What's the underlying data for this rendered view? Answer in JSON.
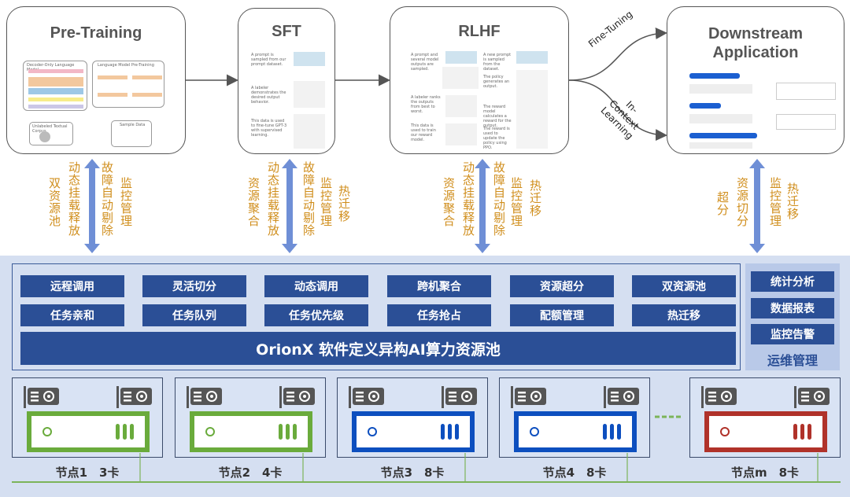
{
  "stages": [
    {
      "title": "Pre-Training",
      "detail": [
        "Decoder-Only Language Model",
        "Language Model Pre-Training",
        "Unlabeled Textual Corpus",
        "Sample Data"
      ]
    },
    {
      "title": "SFT",
      "steps": [
        "A prompt is sampled from our prompt dataset.",
        "A labeler demonstrates the desired output behavior.",
        "This data is used to fine-tune GPT-3 with supervised learning."
      ]
    },
    {
      "title": "RLHF",
      "steps": [
        "A prompt and several model outputs are sampled.",
        "A labeler ranks the outputs from best to worst.",
        "This data is used to train our reward model.",
        "A new prompt is sampled from the dataset.",
        "The policy generates an output.",
        "The reward model calculates a reward for the output.",
        "The reward is used to update the policy using PPO."
      ]
    },
    {
      "title": "Downstream Application"
    }
  ],
  "branch_labels": {
    "fine_tuning": "Fine-Tuning",
    "icl": "In-Context Learning"
  },
  "features": [
    [
      "双资源池",
      "动态挂载释放",
      "故障自动剔除",
      "监控管理"
    ],
    [
      "资源聚合",
      "动态挂载释放",
      "故障自动剔除",
      "监控管理",
      "热迁移"
    ],
    [
      "资源聚合",
      "动态挂载释放",
      "故障自动剔除",
      "监控管理",
      "热迁移"
    ],
    [
      "超分",
      "资源切分",
      "监控管理",
      "热迁移"
    ]
  ],
  "capabilities_row1": [
    "远程调用",
    "灵活切分",
    "动态调用",
    "跨机聚合",
    "资源超分",
    "双资源池"
  ],
  "capabilities_row2": [
    "任务亲和",
    "任务队列",
    "任务优先级",
    "任务抢占",
    "配额管理",
    "热迁移"
  ],
  "pool_title": "OrionX 软件定义异构AI算力资源池",
  "ops": {
    "items": [
      "统计分析",
      "数据报表",
      "监控告警"
    ],
    "title": "运维管理"
  },
  "nodes": [
    {
      "label": "节点1　3卡",
      "color": "#6aab3c"
    },
    {
      "label": "节点2　4卡",
      "color": "#6aab3c"
    },
    {
      "label": "节点3　8卡",
      "color": "#0d4fbf"
    },
    {
      "label": "节点4　8卡",
      "color": "#0d4fbf"
    },
    {
      "label": "节点m　8卡",
      "color": "#b0322a"
    }
  ],
  "colors": {
    "feature_text": "#d08e1c",
    "arrow": "#6f8fd6",
    "panel": "#2b4f96",
    "bus": "#7cb45a"
  }
}
